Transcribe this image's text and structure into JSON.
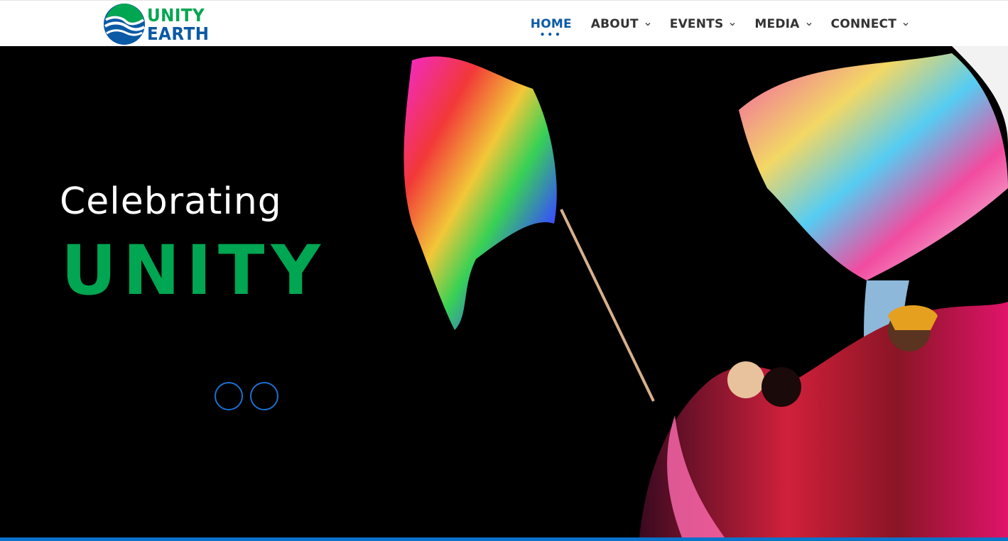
{
  "brand": {
    "logo_line1": "UNITY",
    "logo_line2": "EARTH",
    "logo_icon": "globe-s-icon",
    "green": "#00a651",
    "blue": "#0b5aa6"
  },
  "nav": {
    "items": [
      {
        "label": "HOME",
        "active": true,
        "has_dropdown": false
      },
      {
        "label": "ABOUT",
        "active": false,
        "has_dropdown": true
      },
      {
        "label": "EVENTS",
        "active": false,
        "has_dropdown": true
      },
      {
        "label": "MEDIA",
        "active": false,
        "has_dropdown": true
      },
      {
        "label": "CONNECT",
        "active": false,
        "has_dropdown": true
      }
    ],
    "dropdown_icon": "chevron-down-icon"
  },
  "hero": {
    "subtitle": "Celebrating",
    "title": "UNITY",
    "image": "people-waving-rainbow-flags-on-stage",
    "slides_count": 2
  },
  "colors": {
    "hero_bg": "#000000",
    "bottom_bar": "#0b72c9"
  }
}
